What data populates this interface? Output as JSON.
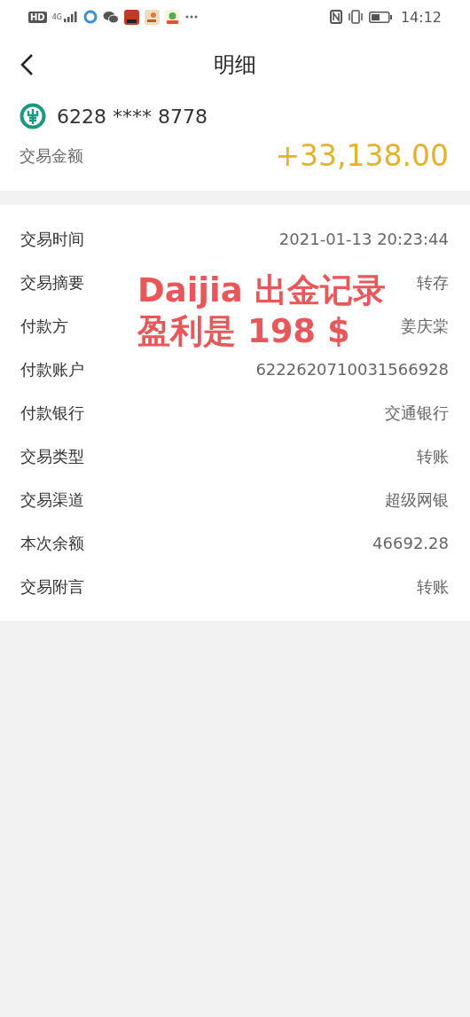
{
  "status_bar": {
    "hd_badge": "HD",
    "network": "4G",
    "time": "14:12"
  },
  "header": {
    "title": "明细"
  },
  "account": {
    "number": "6228 **** 8778",
    "amount_label": "交易金额",
    "amount": "+33,138.00"
  },
  "details": [
    {
      "label": "交易时间",
      "value": "2021-01-13 20:23:44"
    },
    {
      "label": "交易摘要",
      "value": "转存"
    },
    {
      "label": "付款方",
      "value": "姜庆棠"
    },
    {
      "label": "付款账户",
      "value": "6222620710031566928"
    },
    {
      "label": "付款银行",
      "value": "交通银行"
    },
    {
      "label": "交易类型",
      "value": "转账"
    },
    {
      "label": "交易渠道",
      "value": "超级网银"
    },
    {
      "label": "本次余额",
      "value": "46692.28"
    },
    {
      "label": "交易附言",
      "value": "转账"
    }
  ],
  "annotation": {
    "lines": [
      "Daijia 出金记录",
      "盈利是 198 $"
    ]
  }
}
